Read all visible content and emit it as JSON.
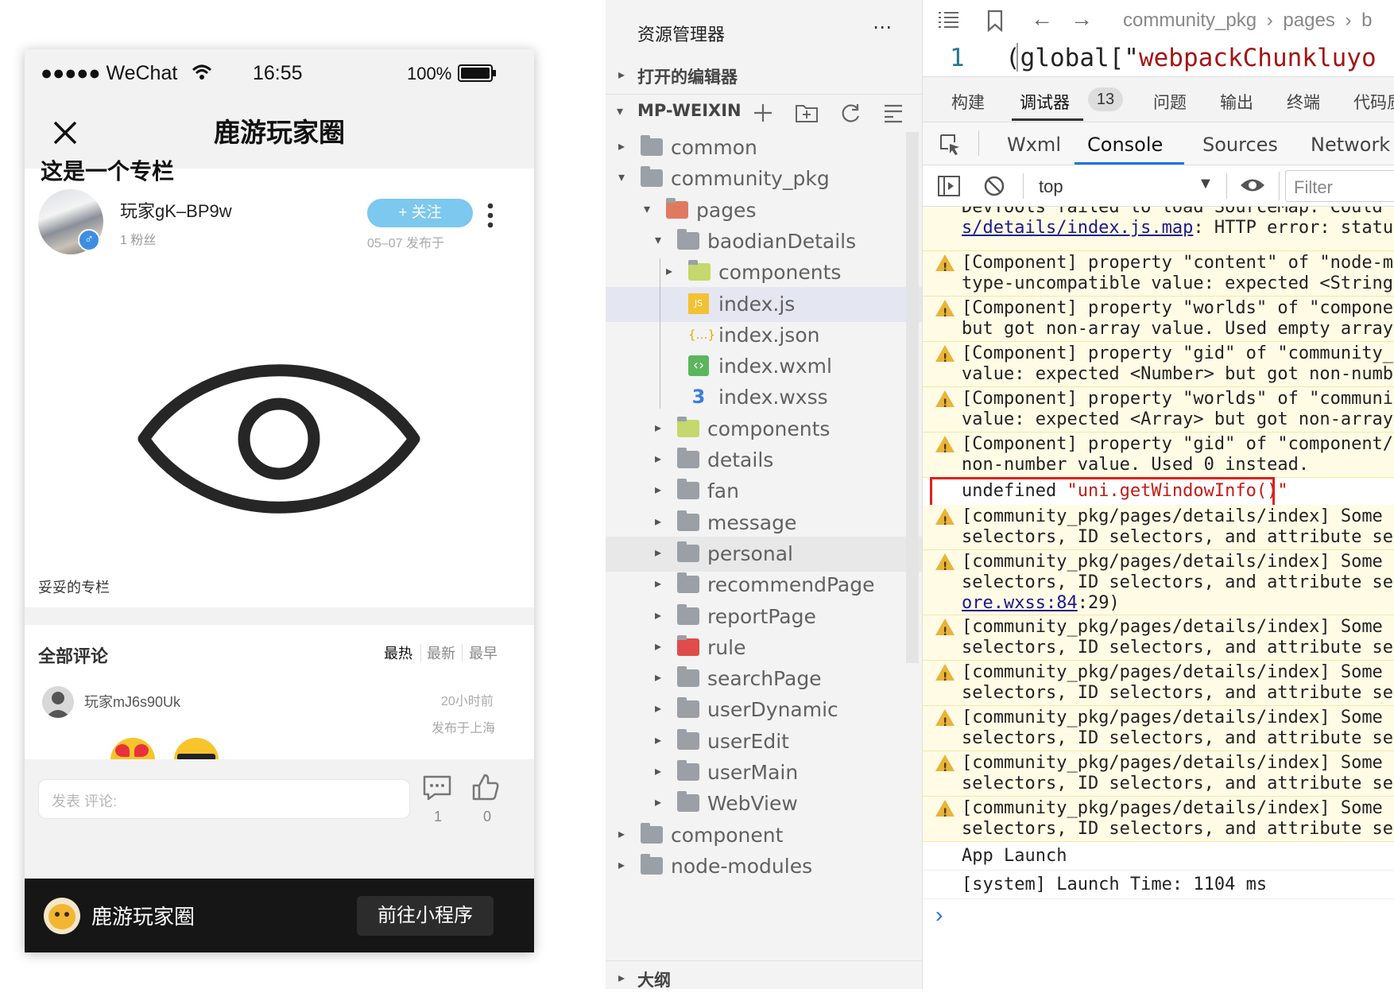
{
  "phone": {
    "status": {
      "carrier": "●●●●● WeChat",
      "time": "16:55",
      "battery": "100%"
    },
    "page_title": "鹿游玩家圈",
    "column_title": "这是一个专栏",
    "author": {
      "name": "玩家gK–BP9w",
      "fans": "1 粉丝",
      "follow_label": "+ 关注",
      "date": "05–07 发布于"
    },
    "column_caption": "妥妥的专栏",
    "comments": {
      "title": "全部评论",
      "sorts": [
        "最热",
        "最新",
        "最早"
      ],
      "items": [
        {
          "user": "玩家mJ6s90Uk",
          "time": "20小时前",
          "location": "发布于上海"
        }
      ]
    },
    "comment_bar": {
      "placeholder": "发表 评论:",
      "comment_count": "1",
      "like_count": "0"
    },
    "footer": {
      "app_name": "鹿游玩家圈",
      "button_label": "前往小程序"
    }
  },
  "explorer": {
    "title": "资源管理器",
    "open_editors": "打开的编辑器",
    "project": "MP-WEIXIN",
    "outline": "大纲",
    "tree": [
      {
        "label": "common",
        "depth": 0,
        "state": "collapsed"
      },
      {
        "label": "community_pkg",
        "depth": 0,
        "state": "expanded"
      },
      {
        "label": "pages",
        "depth": 1,
        "state": "expanded"
      },
      {
        "label": "baodianDetails",
        "depth": 2,
        "state": "expanded"
      },
      {
        "label": "components",
        "depth": 3,
        "state": "collapsed"
      },
      {
        "label": "index.js",
        "depth": 3,
        "state": "file"
      },
      {
        "label": "index.json",
        "depth": 3,
        "state": "file"
      },
      {
        "label": "index.wxml",
        "depth": 3,
        "state": "file"
      },
      {
        "label": "index.wxss",
        "depth": 3,
        "state": "file"
      },
      {
        "label": "components",
        "depth": 2,
        "state": "collapsed"
      },
      {
        "label": "details",
        "depth": 2,
        "state": "collapsed"
      },
      {
        "label": "fan",
        "depth": 2,
        "state": "collapsed"
      },
      {
        "label": "message",
        "depth": 2,
        "state": "collapsed"
      },
      {
        "label": "personal",
        "depth": 2,
        "state": "collapsed"
      },
      {
        "label": "recommendPage",
        "depth": 2,
        "state": "collapsed"
      },
      {
        "label": "reportPage",
        "depth": 2,
        "state": "collapsed"
      },
      {
        "label": "rule",
        "depth": 2,
        "state": "collapsed"
      },
      {
        "label": "searchPage",
        "depth": 2,
        "state": "collapsed"
      },
      {
        "label": "userDynamic",
        "depth": 2,
        "state": "collapsed"
      },
      {
        "label": "userEdit",
        "depth": 2,
        "state": "collapsed"
      },
      {
        "label": "userMain",
        "depth": 2,
        "state": "collapsed"
      },
      {
        "label": "WebView",
        "depth": 2,
        "state": "collapsed"
      },
      {
        "label": "component",
        "depth": 0,
        "state": "collapsed"
      },
      {
        "label": "node-modules",
        "depth": 0,
        "state": "collapsed"
      }
    ]
  },
  "editor": {
    "breadcrumb": [
      "community_pkg",
      "pages",
      "b"
    ],
    "line_number": "1",
    "code_prefix": "(global[\"",
    "code_string": "webpackChunkluyo"
  },
  "devtools": {
    "top_tabs": [
      "构建",
      "调试器",
      "问题",
      "输出",
      "终端",
      "代码质"
    ],
    "debugger_badge": "13",
    "panel_tabs": [
      "Wxml",
      "Console",
      "Sources",
      "Network"
    ],
    "context": "top",
    "filter_placeholder": "Filter",
    "logs": [
      {
        "type": "warn-partial",
        "line1": "DevTools failed to load SourceMap: Could",
        "link": "s/details/index.js.map",
        "line2_rest": ": HTTP error: statu"
      },
      {
        "type": "warn",
        "line1": "[Component] property \"content\" of \"node-m",
        "line2": "type-uncompatible value: expected <String"
      },
      {
        "type": "warn",
        "line1": "[Component] property \"worlds\" of \"compone",
        "line2": "but got non-array value. Used empty array"
      },
      {
        "type": "warn",
        "line1": "[Component] property \"gid\" of \"community_",
        "line2": "value: expected <Number> but got non-numb"
      },
      {
        "type": "warn",
        "line1": "[Component] property \"worlds\" of \"communi",
        "line2": "value: expected <Array> but got non-array"
      },
      {
        "type": "warn",
        "line1": "[Component] property \"gid\" of \"component/",
        "line2": "non-number value. Used 0 instead."
      },
      {
        "type": "log-highlight",
        "text_plain": "undefined ",
        "text_string": "\"uni.getWindowInfo()\""
      },
      {
        "type": "warn",
        "line1": "[community_pkg/pages/details/index] Some",
        "line2": "selectors, ID selectors, and attribute se"
      },
      {
        "type": "warn3",
        "line1": "[community_pkg/pages/details/index] Some",
        "line2": "selectors, ID selectors, and attribute se",
        "link": "ore.wxss:84",
        "line3_rest": ":29)"
      },
      {
        "type": "warn",
        "line1": "[community_pkg/pages/details/index] Some",
        "line2": "selectors, ID selectors, and attribute se"
      },
      {
        "type": "warn",
        "line1": "[community_pkg/pages/details/index] Some",
        "line2": "selectors, ID selectors, and attribute se"
      },
      {
        "type": "warn",
        "line1": "[community_pkg/pages/details/index] Some",
        "line2": "selectors, ID selectors, and attribute se"
      },
      {
        "type": "warn",
        "line1": "[community_pkg/pages/details/index] Some",
        "line2": "selectors, ID selectors, and attribute se"
      },
      {
        "type": "warn",
        "line1": "[community_pkg/pages/details/index] Some",
        "line2": "selectors, ID selectors, and attribute se"
      },
      {
        "type": "log",
        "text": "App Launch"
      },
      {
        "type": "log",
        "text": "[system] Launch Time: 1104 ms"
      }
    ],
    "prompt": "›"
  },
  "colors": {
    "follow_button": "#7cc8ee",
    "accent_tab": "#1a73e8",
    "warn_background": "#fffbe5",
    "highlight_border": "#e0201d",
    "string_red": "#c41a16"
  }
}
